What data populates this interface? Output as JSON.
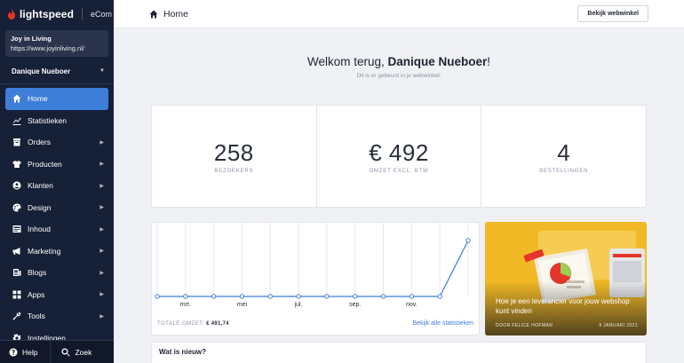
{
  "brand": {
    "name": "lightspeed",
    "product": "eCom",
    "accent": "#e5352b"
  },
  "store": {
    "name": "Joy in Living",
    "url": "https://www.joyinliving.nl/"
  },
  "user": {
    "name": "Danique Nueboer"
  },
  "sidebar": {
    "items": [
      {
        "label": "Home",
        "icon": "home-icon",
        "active": true,
        "has_children": false
      },
      {
        "label": "Statistieken",
        "icon": "chart-icon",
        "active": false,
        "has_children": false
      },
      {
        "label": "Orders",
        "icon": "box-icon",
        "active": false,
        "has_children": true
      },
      {
        "label": "Producten",
        "icon": "shirt-icon",
        "active": false,
        "has_children": true
      },
      {
        "label": "Klanten",
        "icon": "user-icon",
        "active": false,
        "has_children": true
      },
      {
        "label": "Design",
        "icon": "palette-icon",
        "active": false,
        "has_children": true
      },
      {
        "label": "Inhoud",
        "icon": "document-icon",
        "active": false,
        "has_children": true
      },
      {
        "label": "Marketing",
        "icon": "megaphone-icon",
        "active": false,
        "has_children": true
      },
      {
        "label": "Blogs",
        "icon": "blog-icon",
        "active": false,
        "has_children": true
      },
      {
        "label": "Apps",
        "icon": "apps-icon",
        "active": false,
        "has_children": true
      },
      {
        "label": "Tools",
        "icon": "tools-icon",
        "active": false,
        "has_children": true
      },
      {
        "label": "Instellingen",
        "icon": "gear-icon",
        "active": false,
        "has_children": false
      }
    ],
    "active_color": "#3f7ed8"
  },
  "bottom": {
    "help": "Help",
    "search": "Zoek"
  },
  "header": {
    "title": "Home",
    "view_store": "Bekijk webwinkel"
  },
  "welcome": {
    "prefix": "Welkom terug, ",
    "name": "Danique Nueboer",
    "suffix": "!",
    "subtitle": "Dit is er gebeurd in je webwinkel:"
  },
  "stats": [
    {
      "value": "258",
      "label": "BEZOEKERS"
    },
    {
      "value": "€ 492",
      "label": "OMZET EXCL. BTW"
    },
    {
      "value": "4",
      "label": "BESTELLINGEN"
    }
  ],
  "chart_data": {
    "type": "line",
    "x": [
      0,
      1,
      2,
      3,
      4,
      5,
      6,
      7,
      8,
      9,
      10,
      11
    ],
    "x_tick_labels": [
      {
        "x": 1,
        "label": "mrt."
      },
      {
        "x": 3,
        "label": "mei"
      },
      {
        "x": 5,
        "label": "jul."
      },
      {
        "x": 7,
        "label": "sep."
      },
      {
        "x": 9,
        "label": "nov."
      }
    ],
    "values": [
      0,
      0,
      0,
      0,
      0,
      0,
      0,
      0,
      0,
      0,
      0,
      491.74
    ],
    "ylim": [
      0,
      491.74
    ],
    "grid": true,
    "line_color": "#3f7ed8",
    "footer_label": "TOTALE OMZET:",
    "footer_value": "€ 491,74",
    "link": "Bekijk alle statistieken"
  },
  "blog": {
    "title": "Hoe je een leverancier voor jouw webshop kunt vinden",
    "author": "DOOR FELICE HOFMAN",
    "date": "9 JANUARI 2021"
  },
  "news": {
    "title": "Wat is nieuw?"
  }
}
